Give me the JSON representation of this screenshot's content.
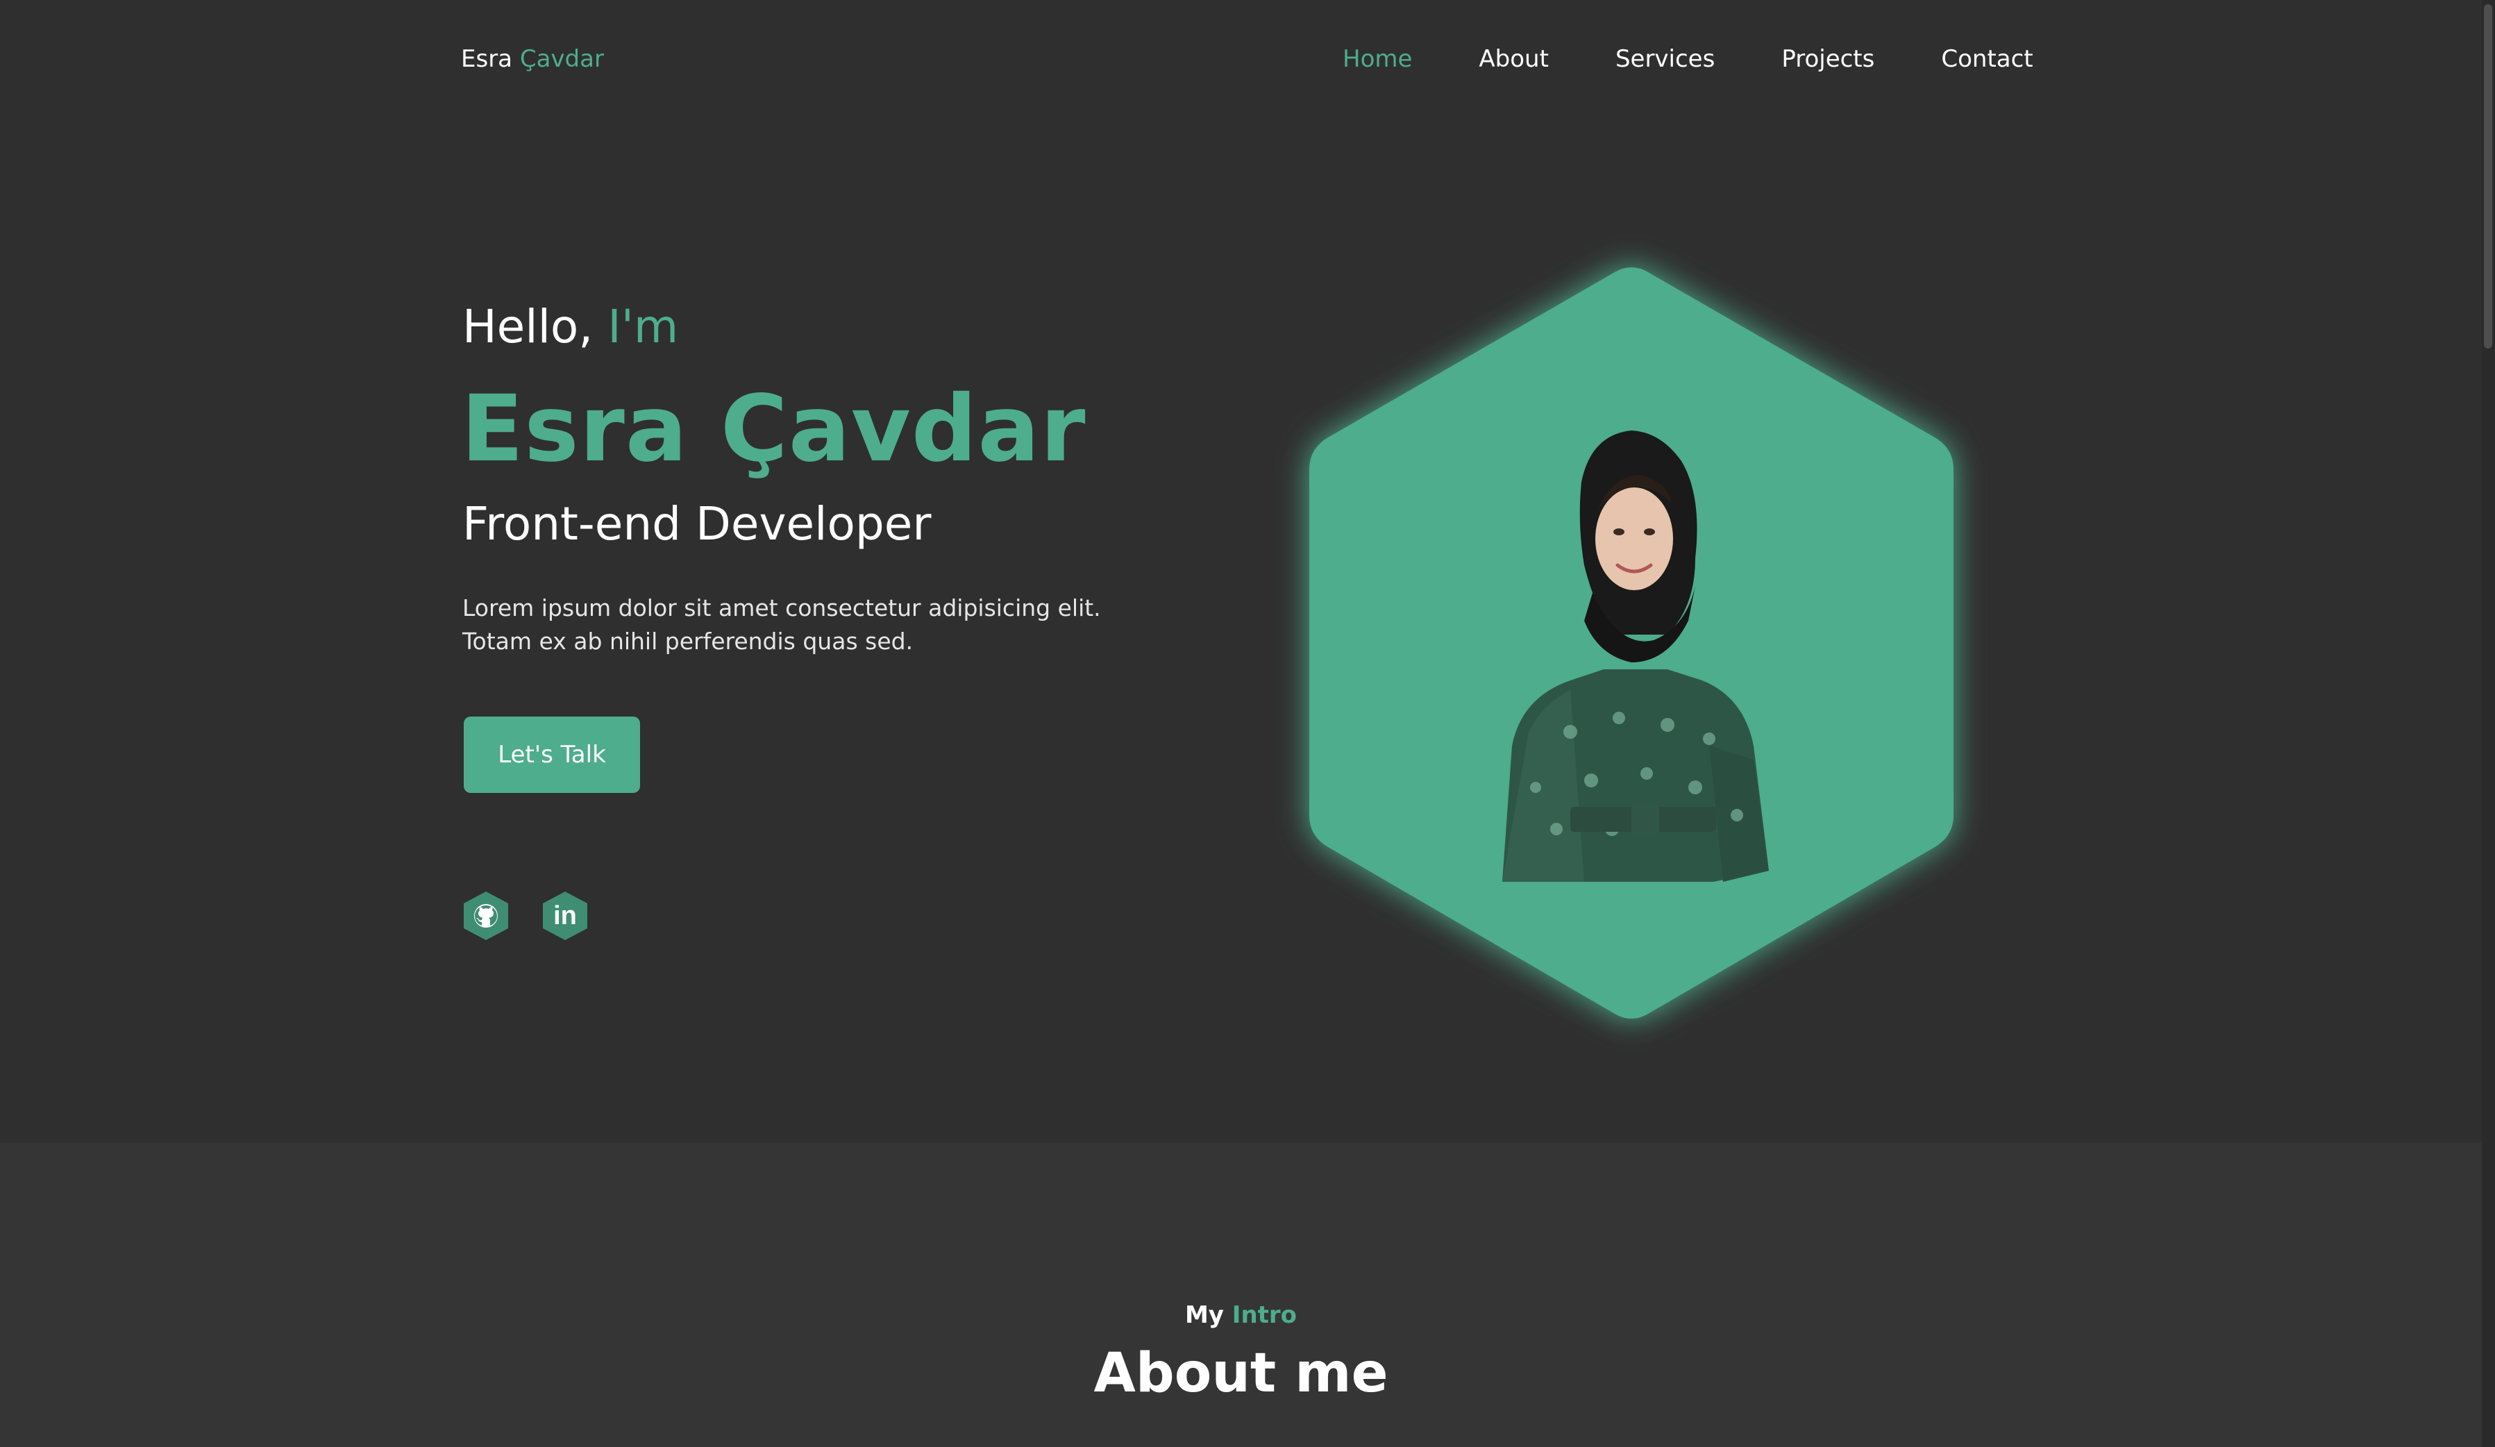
{
  "header": {
    "logo_first": "Esra",
    "logo_accent": "Çavdar",
    "nav": [
      {
        "label": "Home",
        "active": true
      },
      {
        "label": "About",
        "active": false
      },
      {
        "label": "Services",
        "active": false
      },
      {
        "label": "Projects",
        "active": false
      },
      {
        "label": "Contact",
        "active": false
      }
    ]
  },
  "hero": {
    "greeting": "Hello,",
    "greeting_accent": "I'm",
    "name": "Esra Çavdar",
    "role": "Front-end Developer",
    "description_lines": [
      "Lorem ipsum dolor sit amet consectetur adipisicing elit.",
      "Totam ex ab nihil perferendis quas sed."
    ],
    "cta_label": "Let's Talk",
    "socials": [
      {
        "name": "GitHub",
        "icon": "github-icon"
      },
      {
        "name": "LinkedIn",
        "icon": "linkedin-icon",
        "glyph": "in"
      }
    ],
    "portrait_icon": "profile-photo"
  },
  "about": {
    "kicker_first": "My",
    "kicker_accent": "Intro",
    "title": "About me"
  },
  "colors": {
    "accent": "#4ead8c",
    "background": "#2f2f2f",
    "section_background": "#353535",
    "text": "#ffffff"
  }
}
